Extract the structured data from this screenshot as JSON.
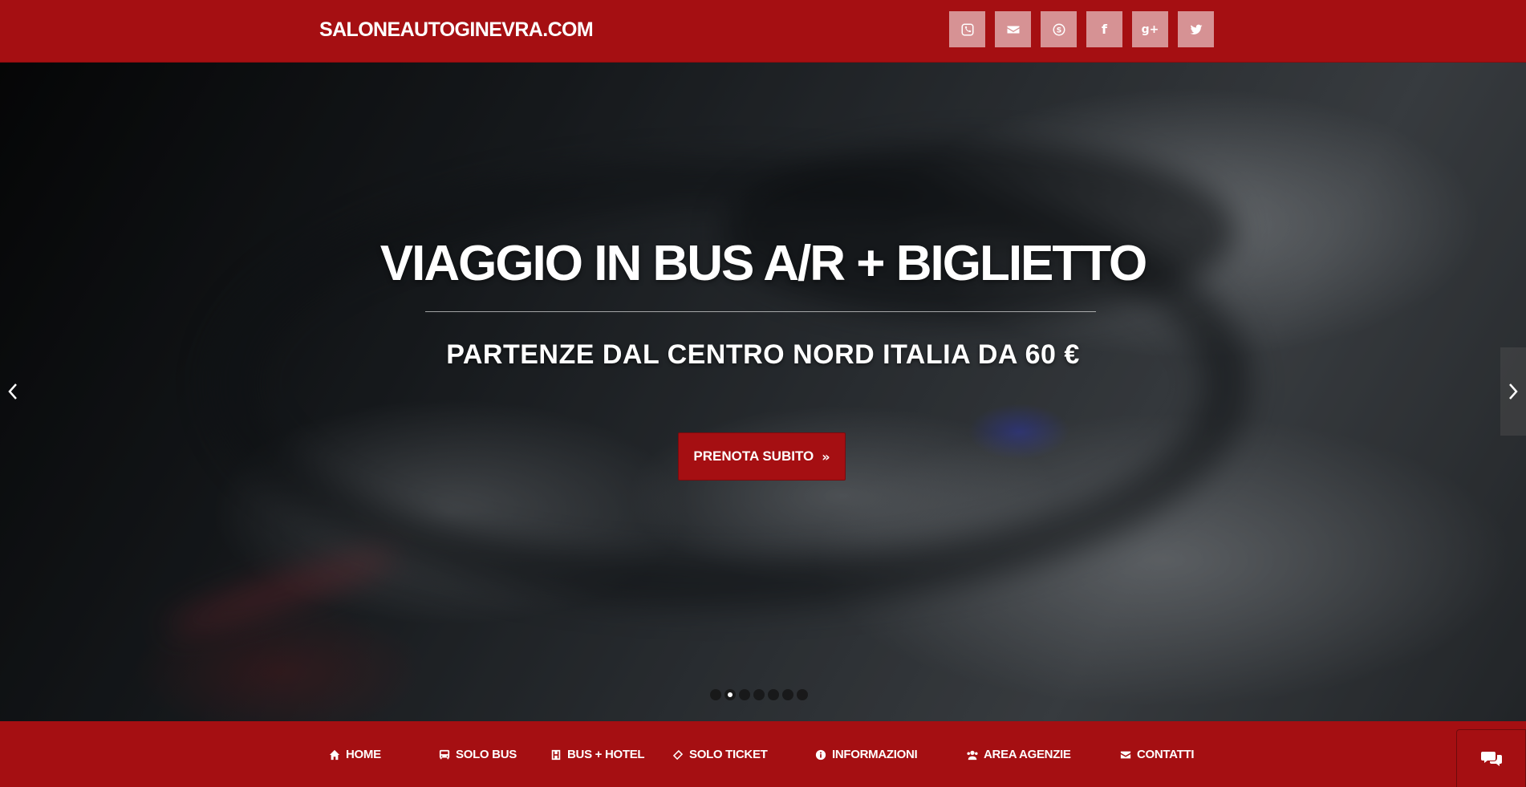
{
  "header": {
    "brand": "SALONEAUTOGINEVRA.COM",
    "social_icons": [
      "phone-icon",
      "envelope-icon",
      "skype-icon",
      "facebook-icon",
      "google-plus-icon",
      "twitter-icon"
    ]
  },
  "hero": {
    "headline": "VIAGGIO IN BUS A/R + BIGLIETTO",
    "subline": "PARTENZE DAL CENTRO NORD ITALIA DA 60 €",
    "cta_label": "PRENOTA SUBITO",
    "slides_count": 7,
    "active_slide": 2
  },
  "nav": {
    "items": [
      {
        "label": "HOME",
        "icon": "home-icon"
      },
      {
        "label": "SOLO BUS",
        "icon": "bus-icon"
      },
      {
        "label": "BUS + HOTEL",
        "icon": "hotel-icon"
      },
      {
        "label": "SOLO TICKET",
        "icon": "ticket-icon"
      },
      {
        "label": "INFORMAZIONI",
        "icon": "info-icon"
      },
      {
        "label": "AREA AGENZIE",
        "icon": "users-icon"
      },
      {
        "label": "CONTATTI",
        "icon": "envelope-icon"
      }
    ]
  },
  "colors": {
    "brand_red": "#a50f12",
    "text": "#ffffff"
  }
}
